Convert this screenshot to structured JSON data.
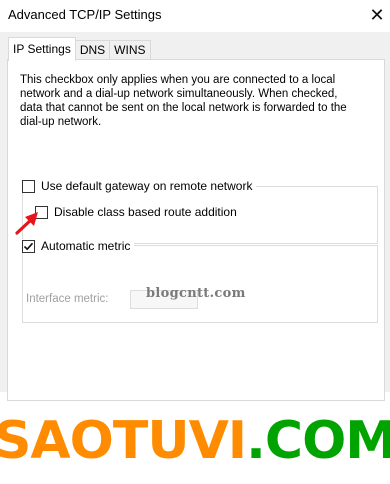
{
  "window": {
    "title": "Advanced TCP/IP Settings",
    "close_glyph": "✕"
  },
  "tabs": [
    {
      "label": "IP Settings",
      "active": true
    },
    {
      "label": "DNS",
      "active": false
    },
    {
      "label": "WINS",
      "active": false
    }
  ],
  "ip_settings": {
    "description": "This checkbox only applies when you are connected to a local network and a dial-up network simultaneously.  When checked, data that cannot be sent on the local network is forwarded to the dial-up network.",
    "use_default_gateway": {
      "label": "Use default gateway on remote network",
      "checked": false
    },
    "disable_class_route": {
      "label": "Disable class based route addition",
      "checked": false
    },
    "automatic_metric": {
      "label": "Automatic metric",
      "checked": true
    },
    "interface_metric": {
      "label": "Interface metric:",
      "value": ""
    }
  },
  "annotation": {
    "arrow_color": "#e8141c",
    "arrow_icon": "red-pointer-arrow-icon"
  },
  "watermarks": {
    "center": "blogcntt.com",
    "brand_part1": "SAOTUVI",
    "brand_part2": ".COM",
    "brand_color1": "#ff8c00",
    "brand_color2": "#00a300"
  }
}
